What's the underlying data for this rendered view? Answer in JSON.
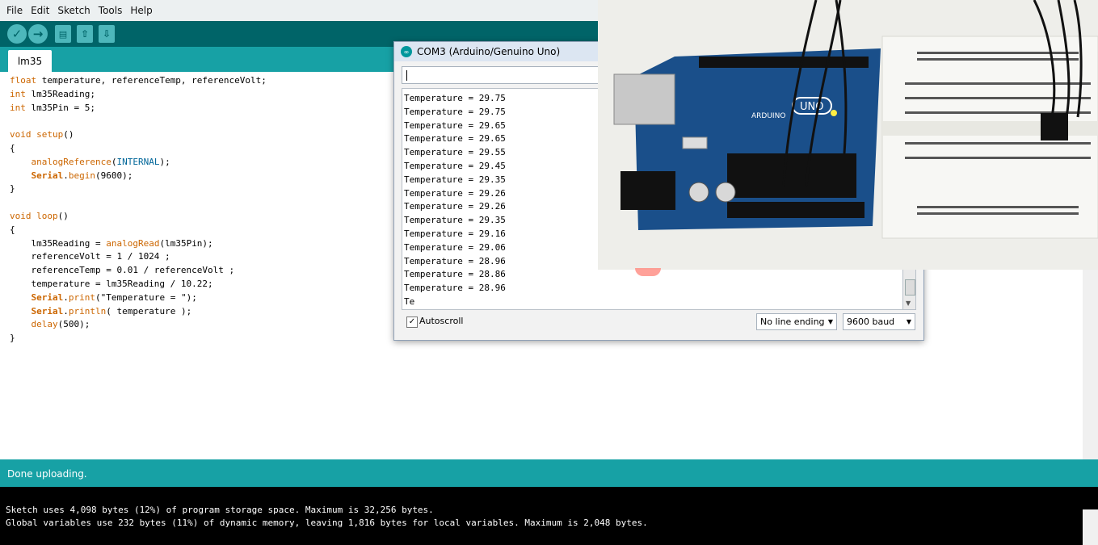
{
  "window": {
    "menu": [
      "File",
      "Edit",
      "Sketch",
      "Tools",
      "Help"
    ]
  },
  "toolbar": {
    "buttons": [
      {
        "name": "verify",
        "icon": "check-icon"
      },
      {
        "name": "upload",
        "icon": "arrow-right-icon"
      },
      {
        "name": "new",
        "icon": "new-file-icon"
      },
      {
        "name": "open",
        "icon": "arrow-up-icon"
      },
      {
        "name": "save",
        "icon": "arrow-down-icon"
      }
    ]
  },
  "tabs": [
    {
      "label": "lm35"
    }
  ],
  "editor": {
    "lines": [
      "float temperature, referenceTemp, referenceVolt;",
      "int lm35Reading;",
      "int lm35Pin = 5;",
      "",
      "void setup()",
      "{",
      "    analogReference(INTERNAL);",
      "    Serial.begin(9600);",
      "}",
      "",
      "void loop()",
      "{",
      "    lm35Reading = analogRead(lm35Pin);",
      "    referenceVolt = 1 / 1024 ;",
      "    referenceTemp = 0.01 / referenceVolt ;",
      "    temperature = lm35Reading / 10.22;",
      "    Serial.print(\"Temperature = \");",
      "    Serial.println( temperature );",
      "    delay(500);",
      "}"
    ]
  },
  "status": {
    "message": "Done uploading."
  },
  "console": {
    "lines": [
      "Sketch uses 4,098 bytes (12%) of program storage space. Maximum is 32,256 bytes.",
      "Global variables use 232 bytes (11%) of dynamic memory, leaving 1,816 bytes for local variables. Maximum is 2,048 bytes."
    ]
  },
  "serial_monitor": {
    "title": "COM3 (Arduino/Genuino Uno)",
    "input_value": "",
    "output_lines": [
      "Temperature = 29.75",
      "Temperature = 29.75",
      "Temperature = 29.65",
      "Temperature = 29.65",
      "Temperature = 29.55",
      "Temperature = 29.45",
      "Temperature = 29.35",
      "Temperature = 29.26",
      "Temperature = 29.26",
      "Temperature = 29.35",
      "Temperature = 29.16",
      "Temperature = 29.06",
      "Temperature = 28.96",
      "Temperature = 28.86",
      "Temperature = 28.96",
      "Te"
    ],
    "autoscroll_label": "Autoscroll",
    "autoscroll_checked": true,
    "line_ending": "No line ending",
    "baud": "9600 baud"
  },
  "overlay_photo": {
    "description_icon": "arduino-board-photo",
    "board_label": "UNO",
    "brand": "ARDUINO"
  },
  "colors": {
    "teal_dark": "#006468",
    "teal": "#17a1a5",
    "keyword": "#cc6600",
    "constant": "#006699"
  }
}
